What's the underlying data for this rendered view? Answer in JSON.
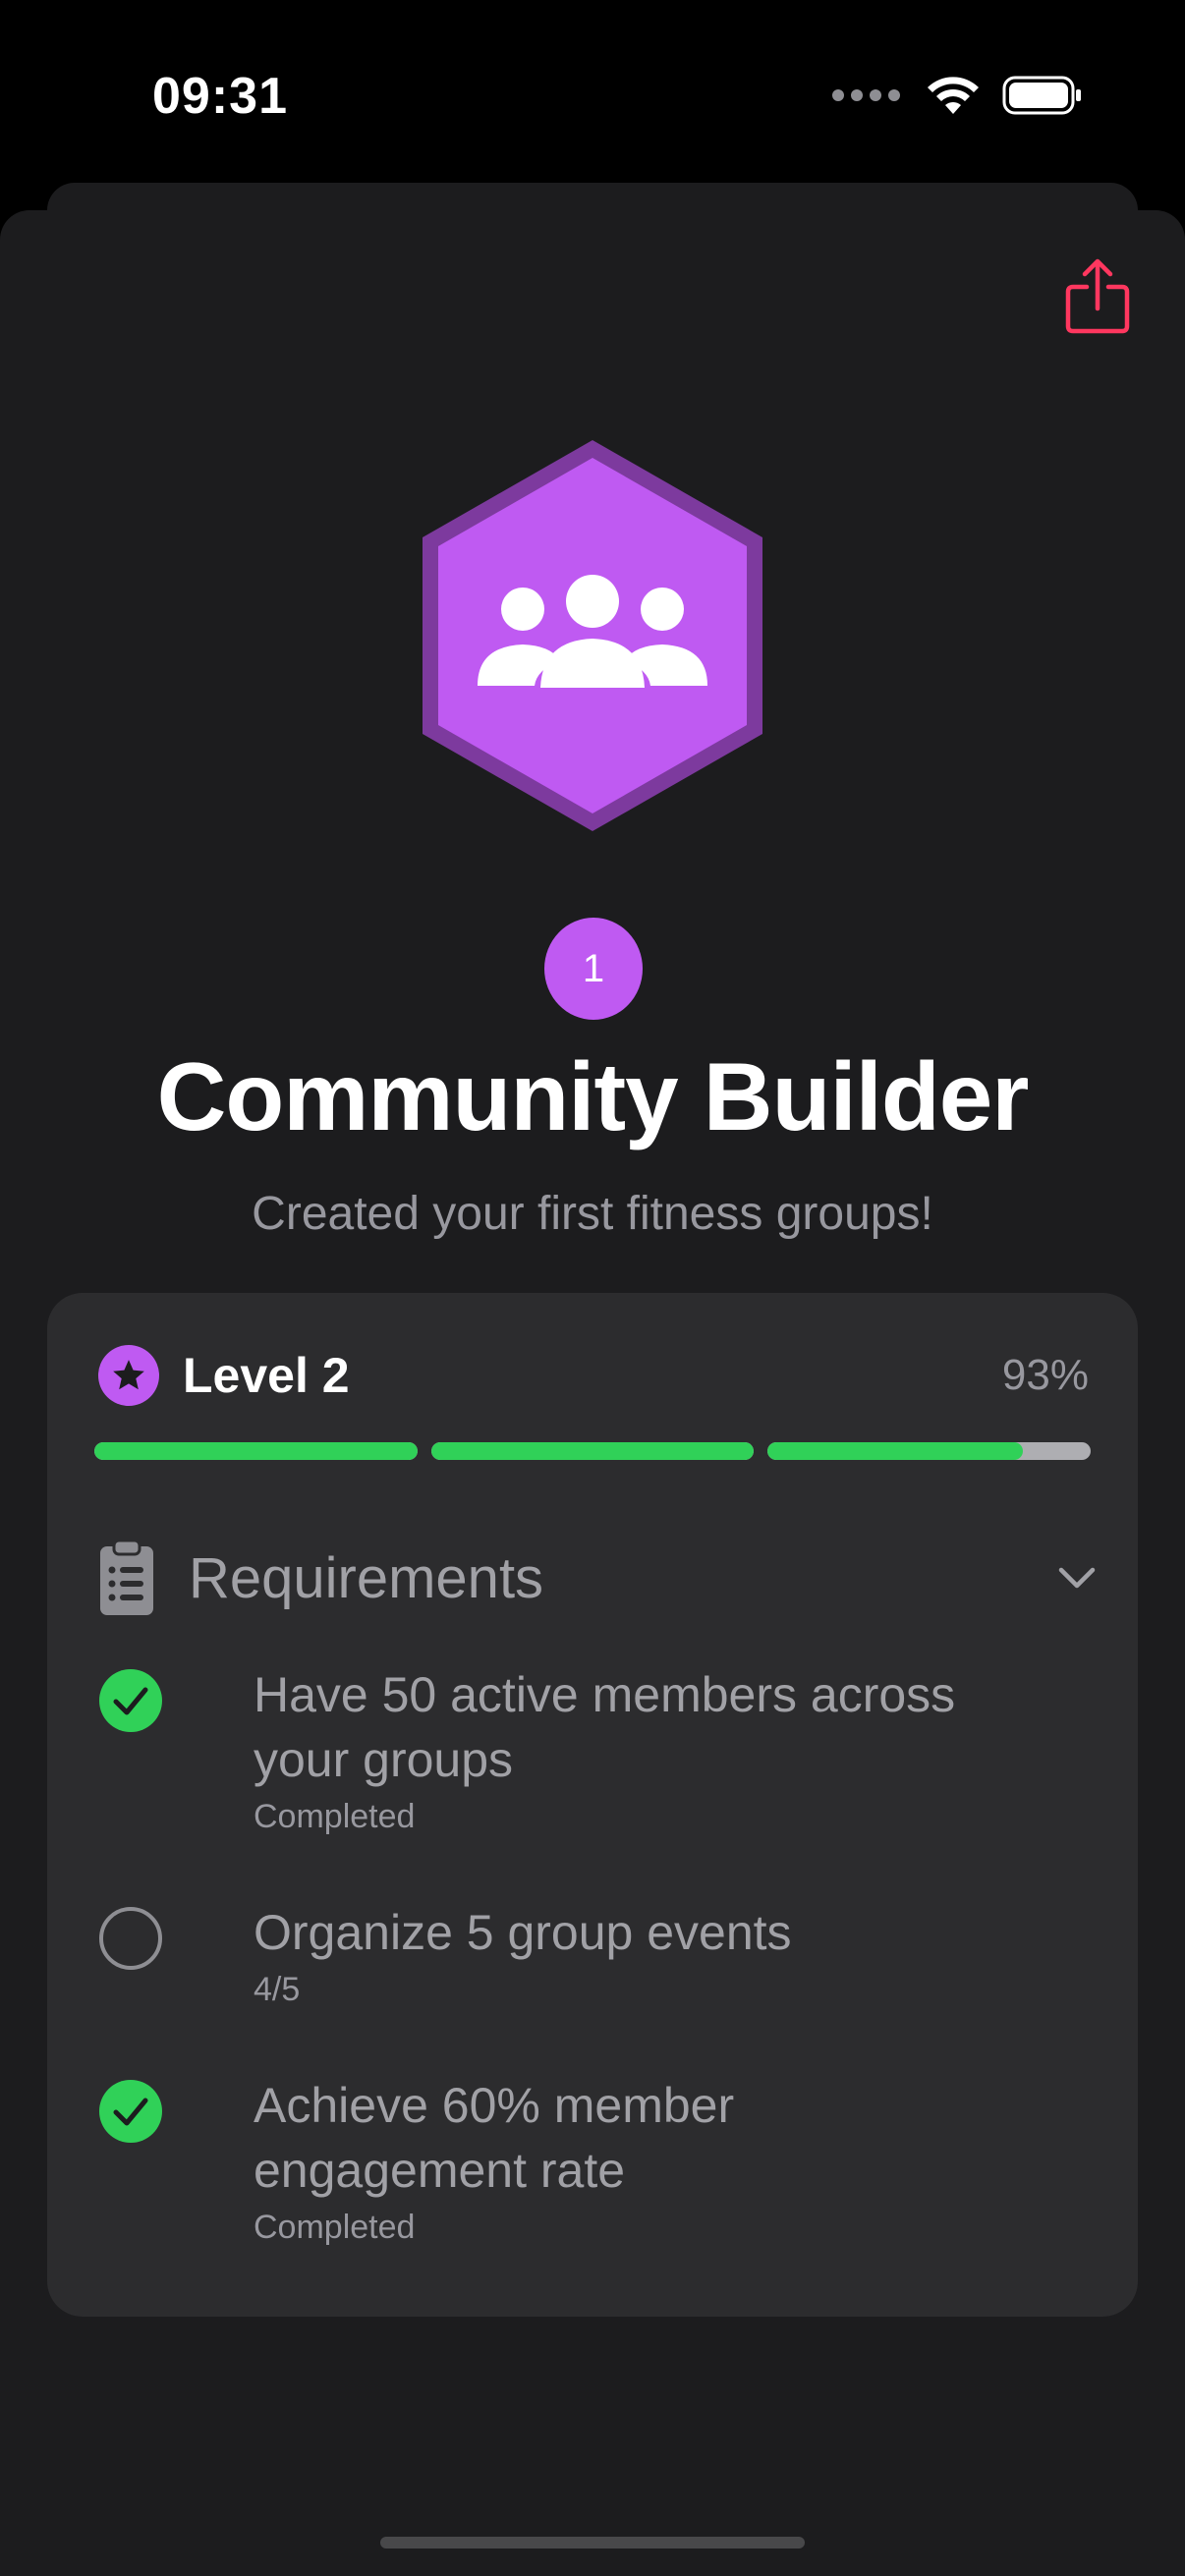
{
  "status_bar": {
    "time": "09:31"
  },
  "badge": {
    "count": "1",
    "title": "Community Builder",
    "subtitle": "Created your first fitness groups!",
    "color": "#bf5af2",
    "icon": "people-group-icon"
  },
  "level": {
    "label": "Level 2",
    "percent_text": "93%",
    "segments": [
      1.0,
      1.0,
      0.79
    ]
  },
  "requirements": {
    "title": "Requirements",
    "items": [
      {
        "line1": "Have 50 active members across",
        "line2": "your groups",
        "status": "Completed",
        "done": true
      },
      {
        "line1": "Organize 5 group events",
        "line2": "",
        "status": "4/5",
        "done": false
      },
      {
        "line1": "Achieve 60% member",
        "line2": "engagement rate",
        "status": "Completed",
        "done": true
      }
    ]
  },
  "colors": {
    "accent": "#bf5af2",
    "success": "#30d158",
    "share": "#ff375f"
  }
}
